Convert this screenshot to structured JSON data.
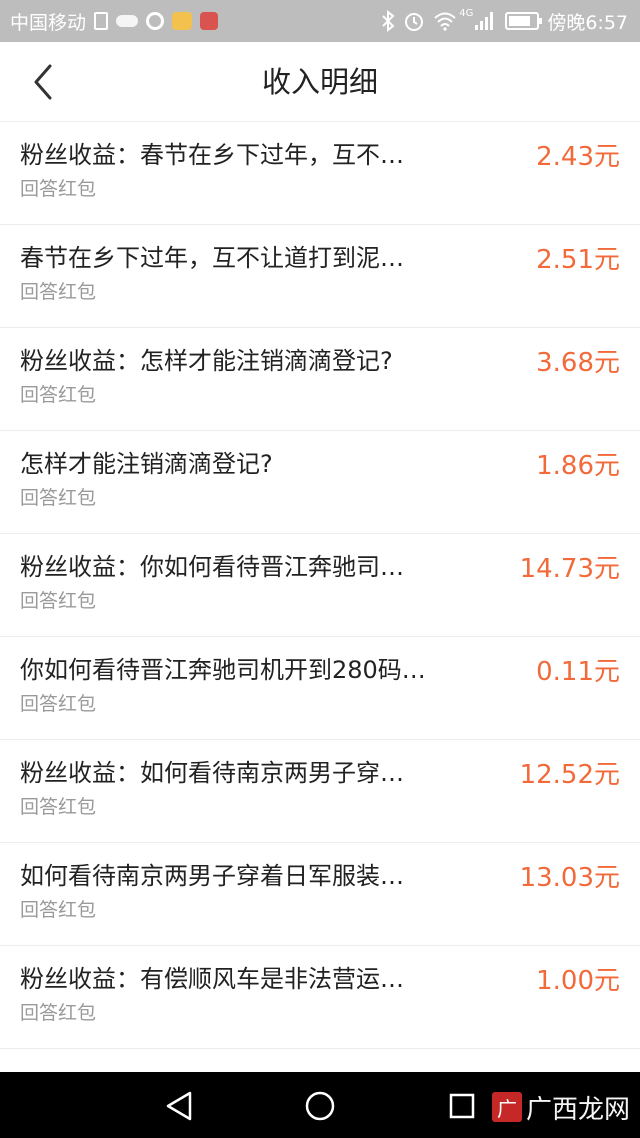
{
  "status_bar": {
    "carrier": "中国移动",
    "network": "4G",
    "time": "傍晚6:57"
  },
  "header": {
    "title": "收入明细"
  },
  "items": [
    {
      "title": "粉丝收益：春节在乡下过年，互不…",
      "subtitle": "回答红包",
      "amount": "2.43元"
    },
    {
      "title": "春节在乡下过年，互不让道打到泥…",
      "subtitle": "回答红包",
      "amount": "2.51元"
    },
    {
      "title": "粉丝收益：怎样才能注销滴滴登记?",
      "subtitle": "回答红包",
      "amount": "3.68元"
    },
    {
      "title": "怎样才能注销滴滴登记?",
      "subtitle": "回答红包",
      "amount": "1.86元"
    },
    {
      "title": "粉丝收益：你如何看待晋江奔驰司…",
      "subtitle": "回答红包",
      "amount": "14.73元"
    },
    {
      "title": "你如何看待晋江奔驰司机开到280码…",
      "subtitle": "回答红包",
      "amount": "0.11元"
    },
    {
      "title": "粉丝收益：如何看待南京两男子穿…",
      "subtitle": "回答红包",
      "amount": "12.52元"
    },
    {
      "title": "如何看待南京两男子穿着日军服装…",
      "subtitle": "回答红包",
      "amount": "13.03元"
    },
    {
      "title": "粉丝收益：有偿顺风车是非法营运…",
      "subtitle": "回答红包",
      "amount": "1.00元"
    }
  ],
  "partial_item_title": "有偿顺风车是非法营运",
  "watermark": "广西龙网",
  "colors": {
    "amount": "#f26a3a",
    "status_bar": "#bdbdbd",
    "nav_bar": "#000000"
  }
}
